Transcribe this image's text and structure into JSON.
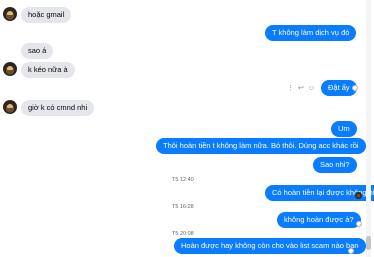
{
  "messages": {
    "m1": "hoặc gmail",
    "m2": "T không làm dịch vụ đó",
    "m3": "sao á",
    "m4": "k kéo nữa à",
    "m5": "Đật ấy",
    "m6": "giờ k có cmnd nhi",
    "m7": "Um",
    "m8": "Thôi hoàn tiền t không làm nữa. Bó thôi. Dùng acc khác rồi",
    "m9": "Sao nhỉ?",
    "m10": "Có hoàn tiền lại được không nhỉ?",
    "m11": "không hoàn được ả?",
    "m12": "Hoàn được hay không còn cho vào list scam nào bạn"
  },
  "timestamps": {
    "t1": "T5 12:40",
    "t2": "T5 16:28",
    "t3": "T5 20:08"
  },
  "actions": {
    "more": "⋮",
    "reply": "↩",
    "react": "☺"
  },
  "colors": {
    "outgoing": "#0a7cff",
    "incoming": "#e4e6eb",
    "timestamp": "#65676b"
  }
}
